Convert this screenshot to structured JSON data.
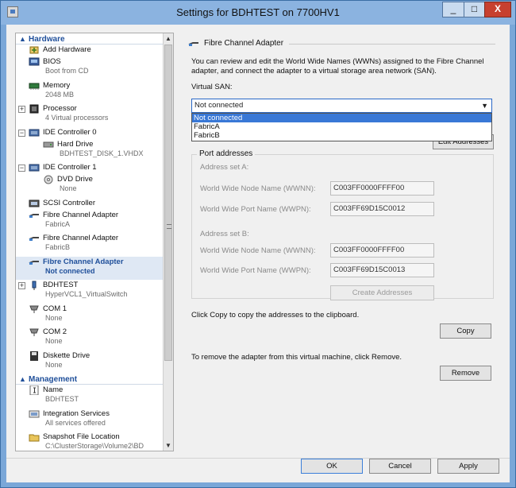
{
  "window": {
    "title": "Settings for BDHTEST on 7700HV1",
    "minimize_label": "_",
    "maximize_label": "□",
    "close_label": "X"
  },
  "tree": {
    "hardware_header": "Hardware",
    "management_header": "Management",
    "hardware_items": [
      {
        "label": "Add Hardware",
        "sub": ""
      },
      {
        "label": "BIOS",
        "sub": "Boot from CD"
      },
      {
        "label": "Memory",
        "sub": "2048 MB"
      },
      {
        "label": "Processor",
        "sub": "4 Virtual processors"
      },
      {
        "label": "IDE Controller 0",
        "sub": ""
      },
      {
        "label": "Hard Drive",
        "sub": "BDHTEST_DISK_1.VHDX"
      },
      {
        "label": "IDE Controller 1",
        "sub": ""
      },
      {
        "label": "DVD Drive",
        "sub": "None"
      },
      {
        "label": "SCSI Controller",
        "sub": ""
      },
      {
        "label": "Fibre Channel Adapter",
        "sub": "FabricA"
      },
      {
        "label": "Fibre Channel Adapter",
        "sub": "FabricB"
      },
      {
        "label": "Fibre Channel Adapter",
        "sub": "Not connected"
      },
      {
        "label": "BDHTEST",
        "sub": "HyperVCL1_VirtualSwitch"
      },
      {
        "label": "COM 1",
        "sub": "None"
      },
      {
        "label": "COM 2",
        "sub": "None"
      },
      {
        "label": "Diskette Drive",
        "sub": "None"
      }
    ],
    "management_items": [
      {
        "label": "Name",
        "sub": "BDHTEST"
      },
      {
        "label": "Integration Services",
        "sub": "All services offered"
      },
      {
        "label": "Snapshot File Location",
        "sub": "C:\\ClusterStorage\\Volume2\\BD"
      }
    ]
  },
  "details": {
    "title": "Fibre Channel Adapter",
    "description_line1": "You can review and edit the World Wide Names (WWNs) assigned to the Fibre Channel",
    "description_line2": "adapter, and connect the adapter to a virtual storage area network (SAN).",
    "virtual_san_label": "Virtual SAN:",
    "virtual_san_selected": "Not connected",
    "virtual_san_options": [
      "Not connected",
      "FabricA",
      "FabricB"
    ],
    "edit_addresses_label": "Edit Addresses",
    "port_addresses_label": "Port addresses",
    "address_set_a_label": "Address set A:",
    "address_set_b_label": "Address set B:",
    "wwnn_label": "World Wide Node Name (WWNN):",
    "wwpn_label": "World Wide Port Name (WWPN):",
    "set_a_wwnn": "C003FF0000FFFF00",
    "set_a_wwpn": "C003FF69D15C0012",
    "set_b_wwnn": "C003FF0000FFFF00",
    "set_b_wwpn": "C003FF69D15C0013",
    "create_addresses_label": "Create Addresses",
    "copy_text": "Click Copy to copy the addresses to the clipboard.",
    "copy_label": "Copy",
    "remove_text": "To remove the adapter from this virtual machine, click Remove.",
    "remove_label": "Remove"
  },
  "footer": {
    "ok_label": "OK",
    "cancel_label": "Cancel",
    "apply_label": "Apply"
  }
}
